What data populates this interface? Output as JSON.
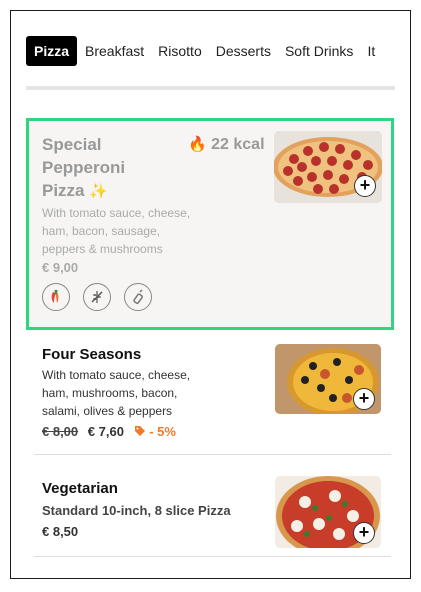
{
  "tabs": [
    {
      "label": "Pizza",
      "active": true
    },
    {
      "label": "Breakfast"
    },
    {
      "label": "Risotto"
    },
    {
      "label": "Desserts"
    },
    {
      "label": "Soft Drinks"
    },
    {
      "label": "It"
    }
  ],
  "special": {
    "title_line1": "Special",
    "title_line2": "Pepperoni",
    "title_line3": "Pizza",
    "sparkle": "✨",
    "kcal": "22 kcal",
    "description": "With tomato sauce, cheese, ham, bacon, sausage, peppers & mushrooms",
    "price": "€ 9,00",
    "icons": [
      "chili-icon",
      "no-gluten-icon",
      "sauce-bottle-icon"
    ]
  },
  "items": [
    {
      "title": "Four Seasons",
      "description": "With tomato sauce, cheese, ham, mushrooms, bacon, salami, olives & peppers",
      "old_price": "€ 8,00",
      "price": "€ 7,60",
      "discount": "- 5%"
    },
    {
      "title": "Vegetarian",
      "description": "Standard 10-inch, 8 slice Pizza",
      "price": "€ 8,50"
    }
  ],
  "colors": {
    "accent_green": "#2ed67f",
    "discount_orange": "#f07a28",
    "active_tab_bg": "#000000"
  }
}
